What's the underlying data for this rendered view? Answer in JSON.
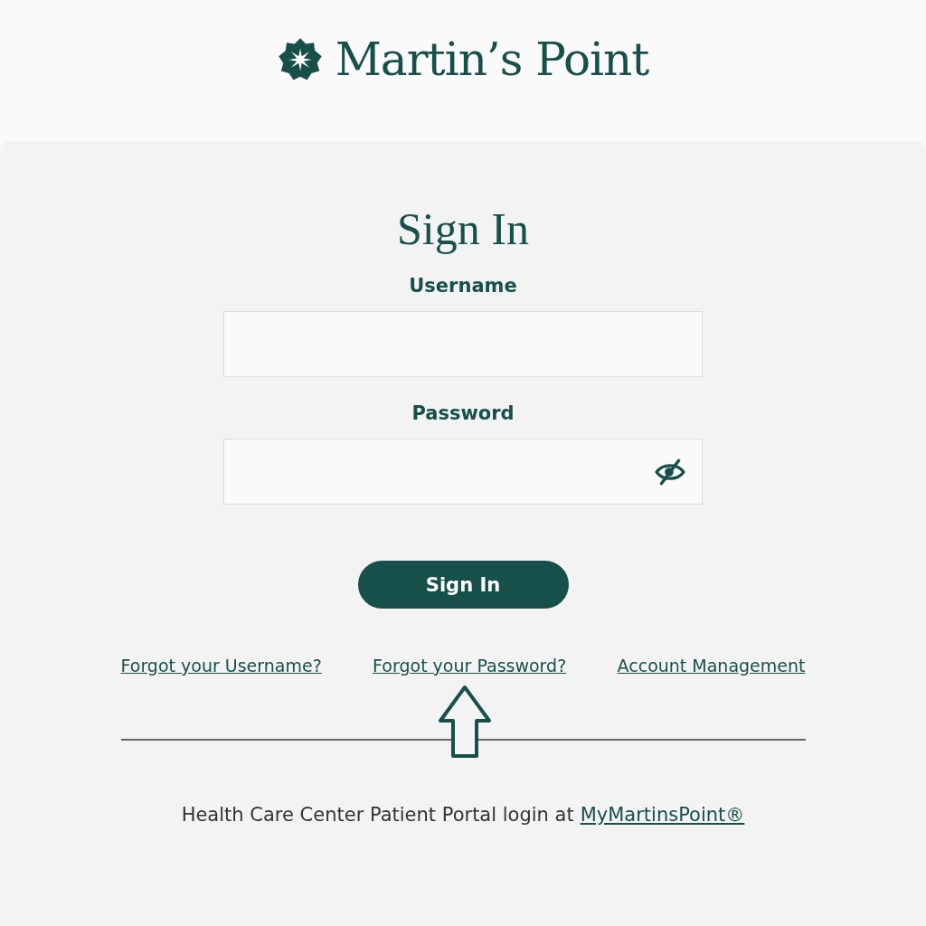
{
  "header": {
    "logo_text": "Martin’s Point"
  },
  "title": "Sign In",
  "fields": [
    {
      "label": "Username",
      "kind": "text"
    },
    {
      "label": "Password",
      "kind": "password"
    }
  ],
  "submit_button": "Sign In",
  "links": [
    "Forgot your Username?",
    "Forgot your Password?",
    "Account Management"
  ],
  "footer": {
    "text": "Health Care Center Patient Portal login at",
    "link": "MyMartinsPoint®"
  }
}
